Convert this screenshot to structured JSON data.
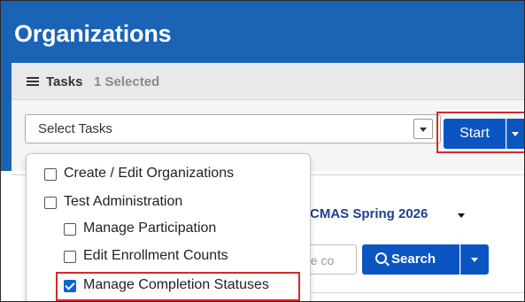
{
  "page": {
    "title": "Organizations"
  },
  "tasks": {
    "label": "Tasks",
    "selected": "1 Selected",
    "select_placeholder": "Select Tasks",
    "start_label": "Start"
  },
  "dropdown": {
    "items": [
      {
        "label": "Create / Edit Organizations",
        "checked": false
      },
      {
        "label": "Test Administration",
        "checked": false
      },
      {
        "label": "Manage Participation",
        "checked": false
      },
      {
        "label": "Edit Enrollment Counts",
        "checked": false
      },
      {
        "label": "Manage Completion Statuses",
        "checked": true
      }
    ]
  },
  "filters": {
    "admin_label": "CMAS Spring 2026",
    "code_placeholder_visible": "de co",
    "search_label": "Search"
  },
  "colors": {
    "header_blue": "#1a63b5",
    "button_blue": "#0b55c2",
    "highlight_red": "#d42a2a"
  },
  "icons": {
    "tasks": "tasks-list-icon",
    "search": "search-icon"
  }
}
